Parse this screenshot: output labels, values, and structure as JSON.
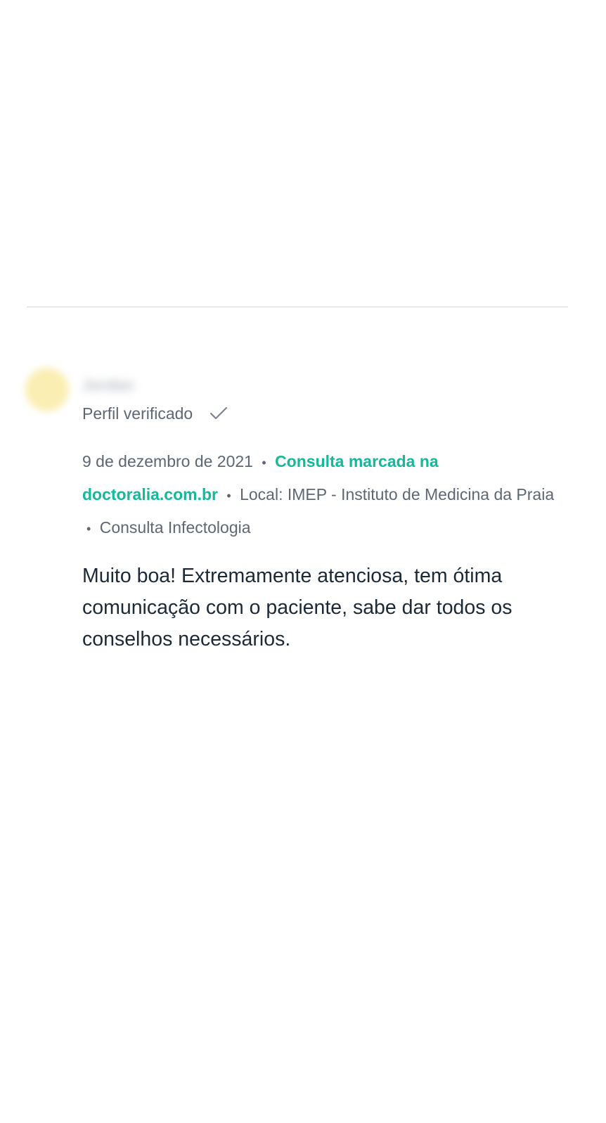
{
  "review": {
    "author_name": "Jordan",
    "verified_label": "Perfil verificado",
    "date": "9 de dezembro de 2021",
    "separator": "•",
    "booked_link": "Consulta marcada na doctoralia.com.br",
    "location": "Local: IMEP - Instituto de Medicina da Praia",
    "visit_type": "Consulta Infectologia",
    "comment": "Muito boa! Extremamente atenciosa, tem ótima comunicação com o paciente, sabe dar todos os conselhos necessários."
  },
  "icons": {
    "verified": "check-icon"
  },
  "colors": {
    "link": "#14b89b",
    "muted_text": "#5e6773",
    "body_text": "#1d2937",
    "avatar": "#fbeeb3"
  }
}
